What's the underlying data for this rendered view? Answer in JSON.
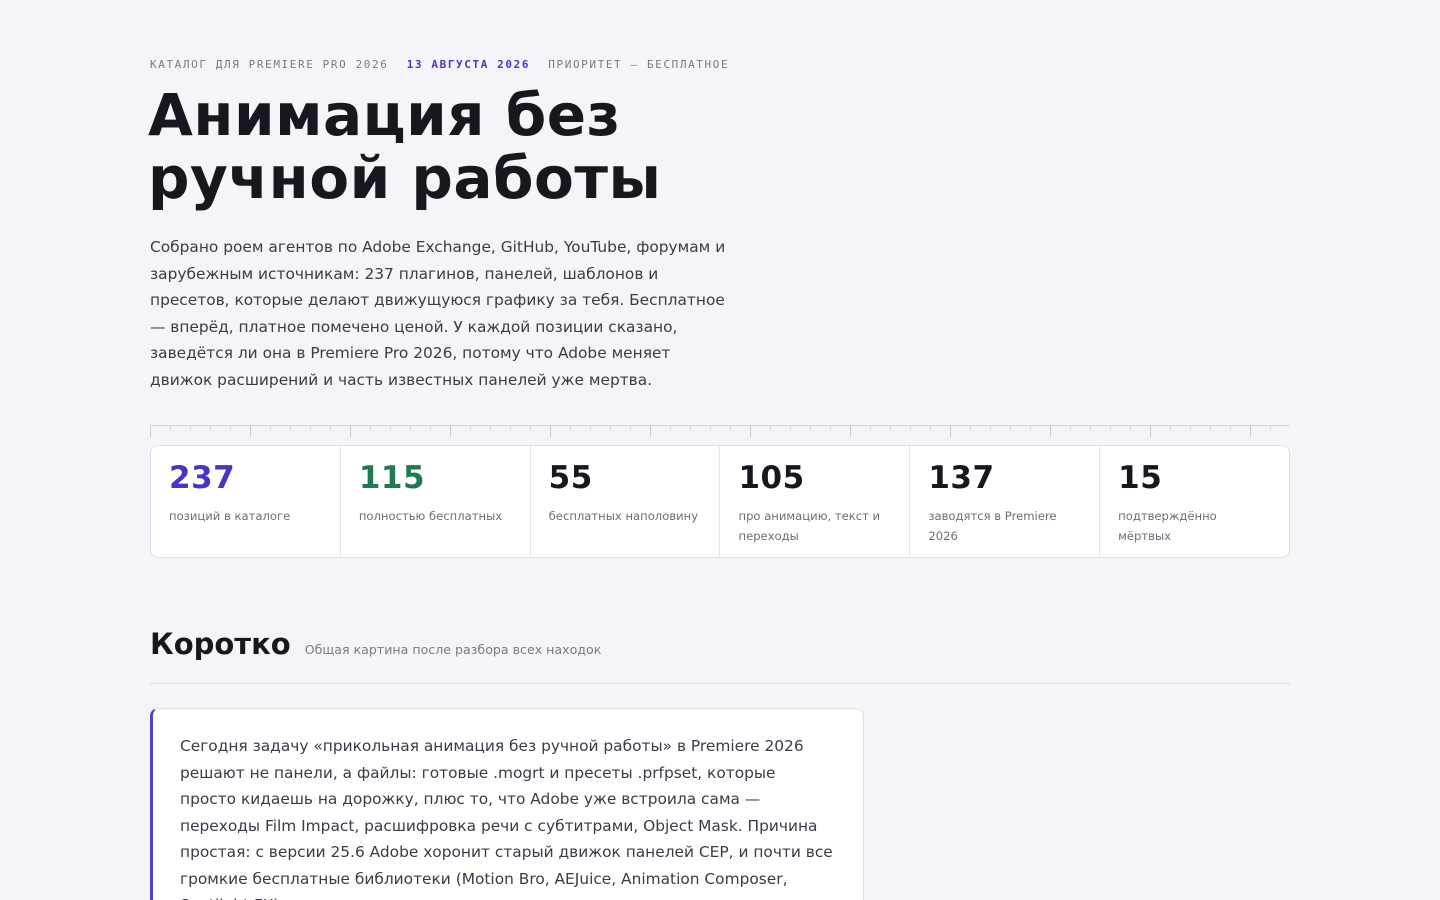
{
  "header": {
    "eyebrow_catalog": "КАТАЛОГ ДЛЯ PREMIERE PRO 2026",
    "eyebrow_date": "13 АВГУСТА 2026",
    "eyebrow_priority": "ПРИОРИТЕТ — БЕСПЛАТНОЕ",
    "title": "Анимация без ручной работы",
    "lead": "Собрано роем агентов по Adobe Exchange, GitHub, YouTube, форумам и зарубежным источникам: 237 плагинов, панелей, шаблонов и пресетов, которые делают движущуюся графику за тебя. Бесплатное — вперёд, платное помечено ценой. У каждой позиции сказано, заведётся ли она в Premiere Pro 2026, потому что Adobe меняет движок расширений и часть известных панелей уже мертва."
  },
  "colors": {
    "accent_purple": "#4a35c0",
    "accent_green": "#1f7a52",
    "text_dark": "#17171f"
  },
  "stats": [
    {
      "value": "237",
      "label": "позиций в каталоге",
      "color": "#4a35c0"
    },
    {
      "value": "115",
      "label": "полностью бесплатных",
      "color": "#1f7a52"
    },
    {
      "value": "55",
      "label": "бесплатных наполовину",
      "color": "#17171f"
    },
    {
      "value": "105",
      "label": "про анимацию, текст и переходы",
      "color": "#17171f"
    },
    {
      "value": "137",
      "label": "заводятся в Premiere 2026",
      "color": "#17171f"
    },
    {
      "value": "15",
      "label": "подтверждённо мёртвых",
      "color": "#17171f"
    }
  ],
  "summary_section": {
    "title": "Коротко",
    "subtitle": "Общая картина после разбора всех находок",
    "text": "Сегодня задачу «прикольная анимация без ручной работы» в Premiere 2026 решают не панели, а файлы: готовые .mogrt и пресеты .prfpset, которые просто кидаешь на дорожку, плюс то, что Adobe уже встроила сама — переходы Film Impact, расшифровка речи с субтитрами, Object Mask. Причина простая: с версии 25.6 Adobe хоронит старый движок панелей CEP, и почти все громкие бесплатные библиотеки (Motion Bro, AEJuice, Animation Composer, Spotlight FX) построены"
  }
}
